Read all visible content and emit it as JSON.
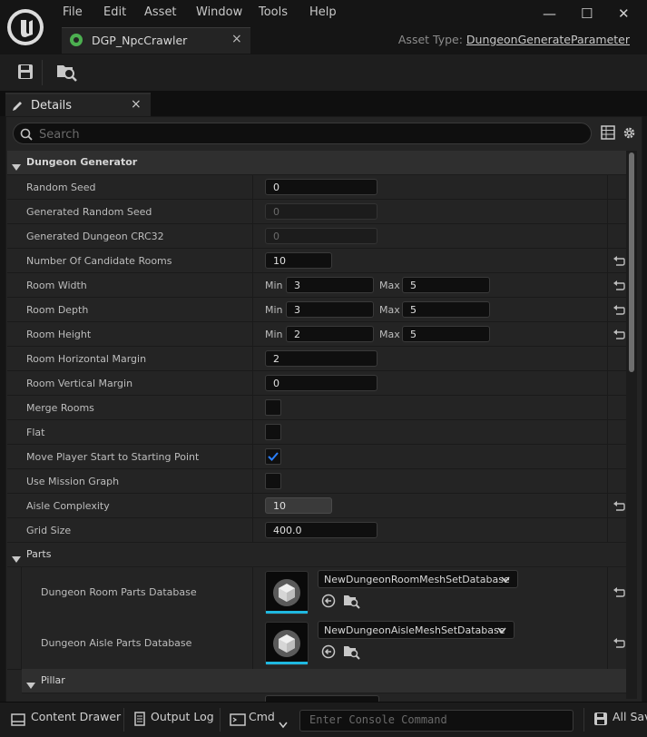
{
  "menu": [
    "File",
    "Edit",
    "Asset",
    "Window",
    "Tools",
    "Help"
  ],
  "window_controls": {
    "minimize": "—",
    "maximize": "☐",
    "close": "✕"
  },
  "doc_tab": {
    "label": "DGP_NpcCrawler",
    "close": "×"
  },
  "asset_type": {
    "prefix": "Asset Type: ",
    "value": "DungeonGenerateParameter"
  },
  "details_tab": {
    "label": "Details",
    "close": "×"
  },
  "search": {
    "placeholder": "Search"
  },
  "sections": {
    "dungeon_generator": "Dungeon Generator",
    "parts": "Parts",
    "pillar": "Pillar"
  },
  "labels": {
    "min": "Min",
    "max": "Max"
  },
  "rows": {
    "random_seed": {
      "label": "Random Seed",
      "value": "0"
    },
    "generated_random_seed": {
      "label": "Generated Random Seed",
      "value": "0"
    },
    "generated_crc": {
      "label": "Generated Dungeon CRC32",
      "value": "0"
    },
    "candidate_rooms": {
      "label": "Number Of Candidate Rooms",
      "value": "10"
    },
    "room_width": {
      "label": "Room Width",
      "min": "3",
      "max": "5"
    },
    "room_depth": {
      "label": "Room Depth",
      "min": "3",
      "max": "5"
    },
    "room_height": {
      "label": "Room Height",
      "min": "2",
      "max": "5"
    },
    "h_margin": {
      "label": "Room Horizontal Margin",
      "value": "2"
    },
    "v_margin": {
      "label": "Room Vertical Margin",
      "value": "0"
    },
    "merge_rooms": {
      "label": "Merge Rooms",
      "checked": false
    },
    "flat": {
      "label": "Flat",
      "checked": false
    },
    "move_player_start": {
      "label": "Move Player Start to Starting Point",
      "checked": true
    },
    "mission_graph": {
      "label": "Use Mission Graph",
      "checked": false
    },
    "aisle_complexity": {
      "label": "Aisle Complexity",
      "value": "10"
    },
    "grid_size": {
      "label": "Grid Size",
      "value": "400.0"
    }
  },
  "parts": {
    "room_db": {
      "label": "Dungeon Room Parts Database",
      "value": "NewDungeonRoomMeshSetDatabase"
    },
    "aisle_db": {
      "label": "Dungeon Aisle Parts Database",
      "value": "NewDungeonAisleMeshSetDatabase"
    }
  },
  "statusbar": {
    "content_drawer": "Content Drawer",
    "output_log": "Output Log",
    "cmd": "Cmd",
    "console_placeholder": "Enter Console Command",
    "all_saved": "All Saved"
  },
  "colors": {
    "accent": "#1fb8e0",
    "check": "#2a7fff",
    "background": "#242424"
  }
}
